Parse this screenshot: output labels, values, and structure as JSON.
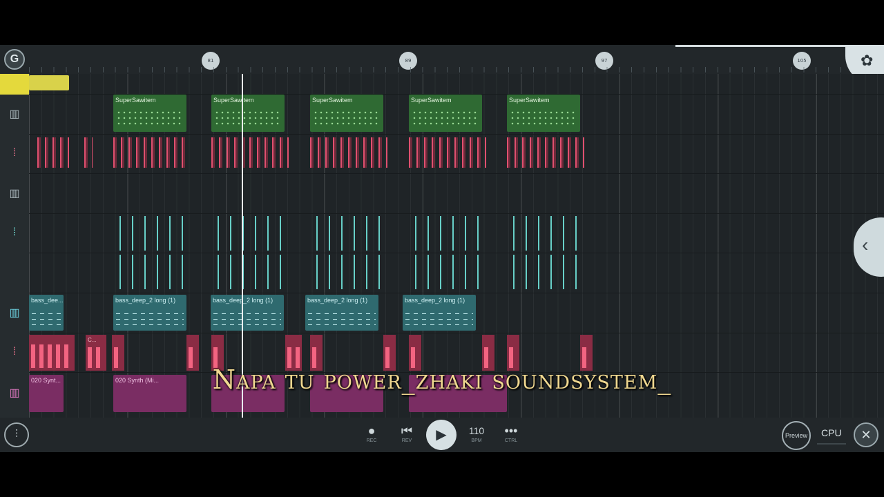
{
  "ruler": {
    "markers": [
      "81",
      "89",
      "97",
      "105"
    ]
  },
  "clips": {
    "supersaw": [
      "SuperSawitem",
      "SuperSawitem",
      "SuperSawitem",
      "SuperSawitem",
      "SuperSawitem"
    ],
    "bass_first": "bass_dee...",
    "bass": [
      "bass_deep_2 long (1)",
      "bass_deep_2 long (1)",
      "bass_deep_2 long (1)",
      "bass_deep_2 long (1)"
    ],
    "synth_first": "020 Synt...",
    "synth": "020 Synth (Mi...",
    "pink_short": "C..."
  },
  "transport": {
    "rec_label": "REC",
    "rev_label": "REV",
    "tempo": "110",
    "bpm_label": "BPM",
    "ctrl_label": "CTRL",
    "preview_label": "Preview",
    "cpu_label": "CPU"
  },
  "subtitle": "Napa tu power_zhaki soundsystem_",
  "colors": {
    "accent_green": "#2f6a33",
    "accent_teal": "#2f6a6f",
    "accent_pink": "#e0506f",
    "playhead": "#e9f0f2"
  }
}
